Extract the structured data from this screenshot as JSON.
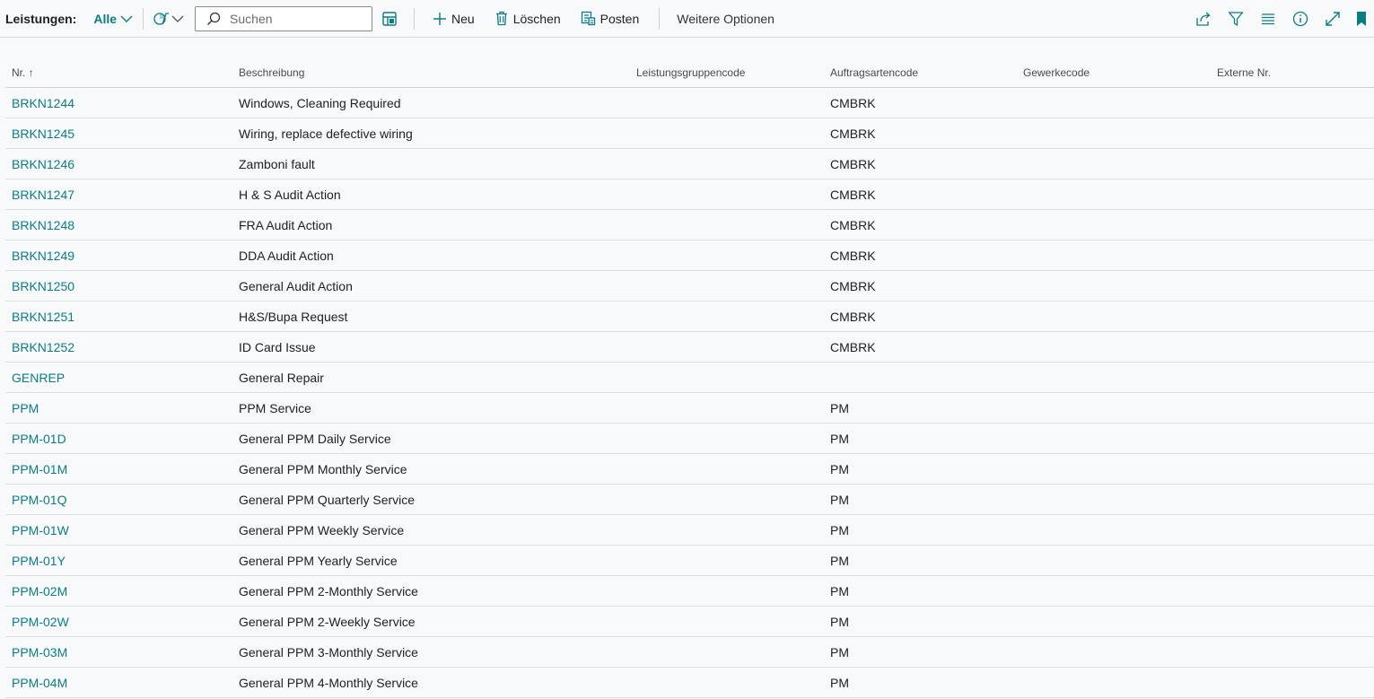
{
  "toolbar": {
    "label": "Leistungen:",
    "view": "Alle",
    "search_placeholder": "Suchen",
    "new_label": "Neu",
    "delete_label": "Löschen",
    "post_label": "Posten",
    "more_label": "Weitere Optionen"
  },
  "columns": {
    "no": "Nr. ↑",
    "description": "Beschreibung",
    "group_code": "Leistungsgruppencode",
    "order_type_code": "Auftragsartencode",
    "trade_code": "Gewerkecode",
    "external_no": "Externe Nr."
  },
  "rows": [
    {
      "no": "BRKN1244",
      "description": "Windows, Cleaning Required",
      "group_code": "",
      "order_type_code": "CMBRK",
      "trade_code": "",
      "external_no": ""
    },
    {
      "no": "BRKN1245",
      "description": "Wiring, replace defective wiring",
      "group_code": "",
      "order_type_code": "CMBRK",
      "trade_code": "",
      "external_no": ""
    },
    {
      "no": "BRKN1246",
      "description": "Zamboni fault",
      "group_code": "",
      "order_type_code": "CMBRK",
      "trade_code": "",
      "external_no": ""
    },
    {
      "no": "BRKN1247",
      "description": "H & S Audit Action",
      "group_code": "",
      "order_type_code": "CMBRK",
      "trade_code": "",
      "external_no": ""
    },
    {
      "no": "BRKN1248",
      "description": "FRA Audit Action",
      "group_code": "",
      "order_type_code": "CMBRK",
      "trade_code": "",
      "external_no": ""
    },
    {
      "no": "BRKN1249",
      "description": "DDA Audit Action",
      "group_code": "",
      "order_type_code": "CMBRK",
      "trade_code": "",
      "external_no": ""
    },
    {
      "no": "BRKN1250",
      "description": "General Audit Action",
      "group_code": "",
      "order_type_code": "CMBRK",
      "trade_code": "",
      "external_no": ""
    },
    {
      "no": "BRKN1251",
      "description": "H&S/Bupa Request",
      "group_code": "",
      "order_type_code": "CMBRK",
      "trade_code": "",
      "external_no": ""
    },
    {
      "no": "BRKN1252",
      "description": "ID Card Issue",
      "group_code": "",
      "order_type_code": "CMBRK",
      "trade_code": "",
      "external_no": ""
    },
    {
      "no": "GENREP",
      "description": "General Repair",
      "group_code": "",
      "order_type_code": "",
      "trade_code": "",
      "external_no": ""
    },
    {
      "no": "PPM",
      "description": "PPM Service",
      "group_code": "",
      "order_type_code": "PM",
      "trade_code": "",
      "external_no": ""
    },
    {
      "no": "PPM-01D",
      "description": "General PPM Daily Service",
      "group_code": "",
      "order_type_code": "PM",
      "trade_code": "",
      "external_no": ""
    },
    {
      "no": "PPM-01M",
      "description": "General PPM Monthly Service",
      "group_code": "",
      "order_type_code": "PM",
      "trade_code": "",
      "external_no": ""
    },
    {
      "no": "PPM-01Q",
      "description": "General PPM Quarterly Service",
      "group_code": "",
      "order_type_code": "PM",
      "trade_code": "",
      "external_no": ""
    },
    {
      "no": "PPM-01W",
      "description": "General PPM Weekly Service",
      "group_code": "",
      "order_type_code": "PM",
      "trade_code": "",
      "external_no": ""
    },
    {
      "no": "PPM-01Y",
      "description": "General PPM Yearly Service",
      "group_code": "",
      "order_type_code": "PM",
      "trade_code": "",
      "external_no": ""
    },
    {
      "no": "PPM-02M",
      "description": "General PPM 2-Monthly Service",
      "group_code": "",
      "order_type_code": "PM",
      "trade_code": "",
      "external_no": ""
    },
    {
      "no": "PPM-02W",
      "description": "General PPM 2-Weekly Service",
      "group_code": "",
      "order_type_code": "PM",
      "trade_code": "",
      "external_no": ""
    },
    {
      "no": "PPM-03M",
      "description": "General PPM 3-Monthly Service",
      "group_code": "",
      "order_type_code": "PM",
      "trade_code": "",
      "external_no": ""
    },
    {
      "no": "PPM-04M",
      "description": "General PPM 4-Monthly Service",
      "group_code": "",
      "order_type_code": "PM",
      "trade_code": "",
      "external_no": ""
    }
  ],
  "icons": {
    "view_chevron": "chevron-down-icon",
    "analysis": "analysis-mode-icon",
    "search": "search-icon",
    "layout": "layout-icon",
    "new": "plus-icon",
    "delete": "trash-icon",
    "post": "post-icon",
    "share": "share-icon",
    "filter": "filter-icon",
    "list": "list-icon",
    "info": "info-icon",
    "expand": "expand-icon",
    "bookmark": "bookmark-icon"
  },
  "colors": {
    "accent": "#0a7d83",
    "background": "#f8f9fb",
    "text": "#212121"
  }
}
